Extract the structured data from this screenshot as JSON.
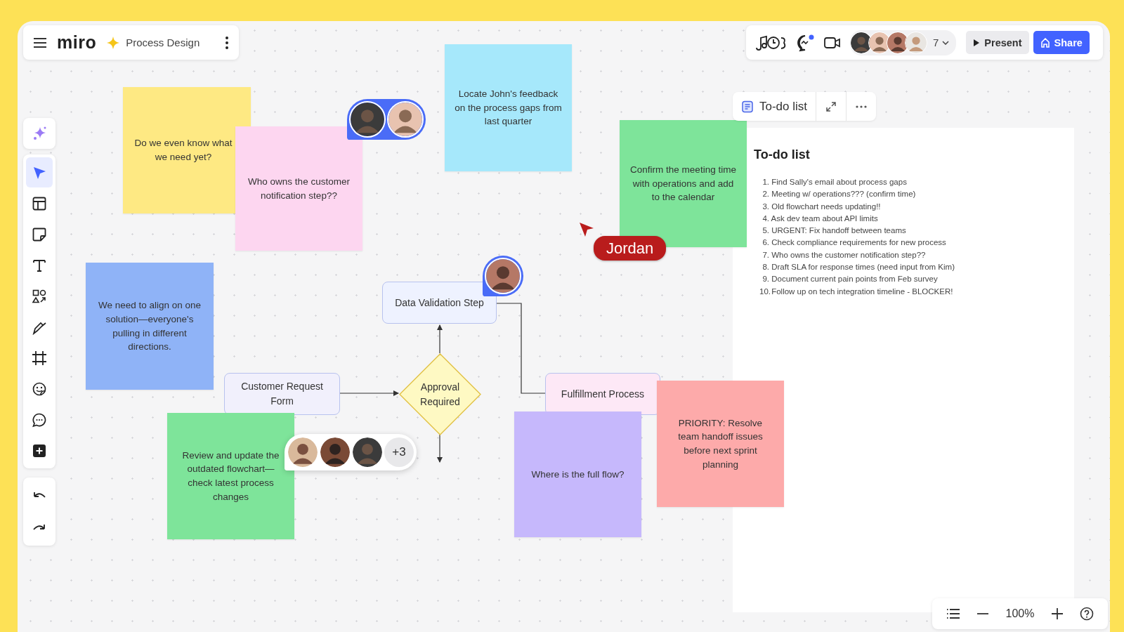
{
  "header": {
    "logo": "miro",
    "board_title": "Process Design"
  },
  "collaborators": {
    "count": "7"
  },
  "buttons": [
    {
      "label": "Present",
      "kind": "secondary"
    },
    {
      "label": "Share",
      "kind": "primary"
    }
  ],
  "tools": [
    {
      "kind": "select",
      "selected": true
    },
    {
      "kind": "templates",
      "selected": false
    },
    {
      "kind": "sticky",
      "selected": false
    },
    {
      "kind": "text",
      "selected": false
    },
    {
      "kind": "shapes",
      "selected": false
    },
    {
      "kind": "pen",
      "selected": false
    },
    {
      "kind": "frame",
      "selected": false
    },
    {
      "kind": "sticker",
      "selected": false
    },
    {
      "kind": "comment",
      "selected": false
    },
    {
      "kind": "more",
      "selected": false
    }
  ],
  "sticky_notes": [
    {
      "text": "Do we even know what we need yet?",
      "color": "#fee983"
    },
    {
      "text": "Who owns the customer notification step??",
      "color": "#fdd6f0"
    },
    {
      "text": "Locate John's feedback on the process gaps from last quarter",
      "color": "#a6e8fb"
    },
    {
      "text": "Confirm the meeting time with operations and add to the calendar",
      "color": "#7ee49a"
    },
    {
      "text": "We need to align on one solution—everyone's pulling in different directions.",
      "color": "#8fb3f7"
    },
    {
      "text": "Review and update the outdated flowchart—check latest process changes",
      "color": "#7ee49a"
    },
    {
      "text": "Where is the full flow?",
      "color": "#c6b8fc"
    },
    {
      "text": "PRIORITY: Resolve team handoff issues before next sprint planning",
      "color": "#fdaaaa"
    }
  ],
  "flow_shapes": [
    {
      "kind": "process",
      "text": "Data Validation Step",
      "color": "#eef2ff"
    },
    {
      "kind": "process",
      "text": "Customer Request Form",
      "color": "#f1f0fc"
    },
    {
      "kind": "decision",
      "text": "Approval Required",
      "color": "#fef9c3"
    },
    {
      "kind": "process",
      "text": "Fulfillment Process",
      "color": "#fde8f6"
    }
  ],
  "comment_threads": [
    {
      "kind": "active"
    },
    {
      "kind": "active"
    },
    {
      "kind": "plain",
      "more": "+3"
    }
  ],
  "cursor": {
    "name": "Jordan",
    "color": "#b91c1c"
  },
  "todo": {
    "toolbar_label": "To-do list",
    "title": "To-do list",
    "items": [
      {
        "number": "1.",
        "text": "Find Sally's email about process gaps"
      },
      {
        "number": "2.",
        "text": "Meeting w/ operations??? (confirm time)"
      },
      {
        "number": "3.",
        "text": "Old flowchart needs updating!!"
      },
      {
        "number": "4.",
        "text": "Ask dev team about API limits"
      },
      {
        "number": "5.",
        "text": "URGENT: Fix handoff between teams"
      },
      {
        "number": "6.",
        "text": "Check compliance requirements for new process"
      },
      {
        "number": "7.",
        "text": "Who owns the customer notification step??"
      },
      {
        "number": "8.",
        "text": "Draft SLA for response times (need input from Kim)"
      },
      {
        "number": "9.",
        "text": "Document current pain points from Feb survey"
      },
      {
        "number": "10.",
        "text": "Follow up on tech integration timeline - BLOCKER!"
      }
    ]
  },
  "zoom": {
    "value": "100%"
  }
}
